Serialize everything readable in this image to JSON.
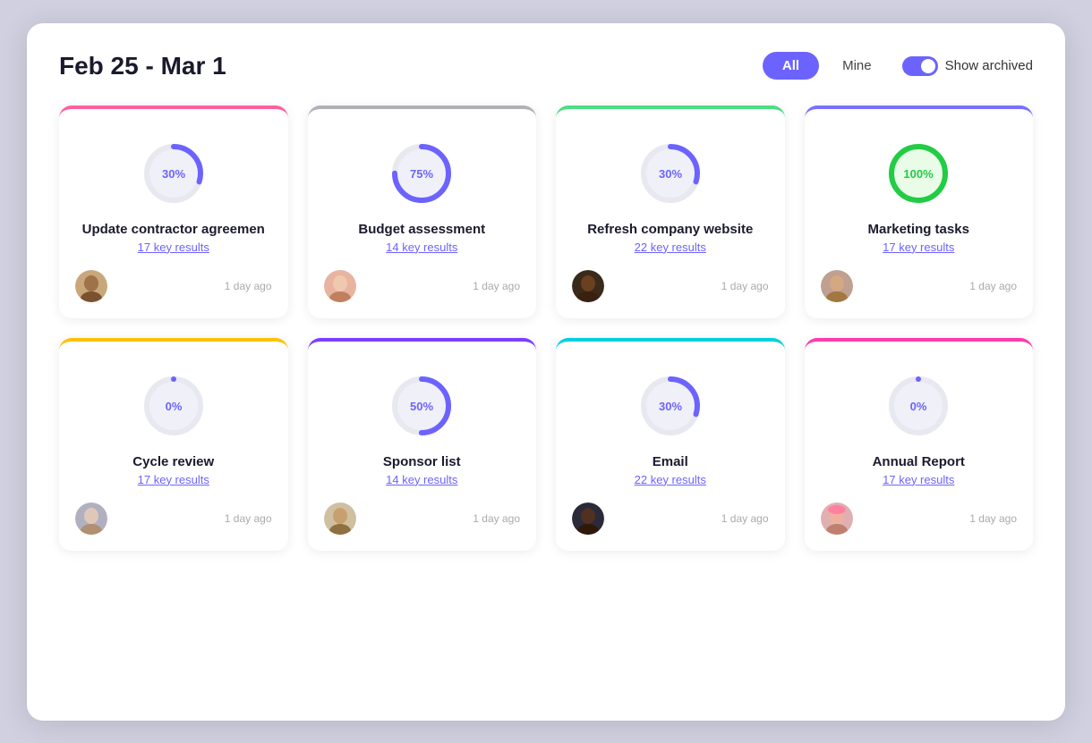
{
  "header": {
    "title": "Feb 25 - Mar 1",
    "btn_all": "All",
    "btn_mine": "Mine",
    "show_archived": "Show archived",
    "toggle_on": true
  },
  "cards": [
    {
      "id": 1,
      "title": "Update contractor agreemen",
      "key_results": "17 key results",
      "progress": 30,
      "time": "1 day ago",
      "border_color": "#ff5f9e",
      "ring_color": "#6c63ff",
      "avatar_class": "avatar-1",
      "row": 1
    },
    {
      "id": 2,
      "title": "Budget assessment",
      "key_results": "14 key results",
      "progress": 75,
      "time": "1 day ago",
      "border_color": "#b0b0b8",
      "ring_color": "#6c63ff",
      "avatar_class": "avatar-2",
      "row": 1
    },
    {
      "id": 3,
      "title": "Refresh company website",
      "key_results": "22 key results",
      "progress": 30,
      "time": "1 day ago",
      "border_color": "#4cde80",
      "ring_color": "#6c63ff",
      "avatar_class": "avatar-3",
      "row": 1
    },
    {
      "id": 4,
      "title": "Marketing tasks",
      "key_results": "17 key results",
      "progress": 100,
      "time": "1 day ago",
      "border_color": "#7b6fff",
      "ring_color": "#22cc44",
      "avatar_class": "avatar-4",
      "row": 1
    },
    {
      "id": 5,
      "title": "Cycle review",
      "key_results": "17 key results",
      "progress": 0,
      "time": "1 day ago",
      "border_color": "#ffc107",
      "ring_color": "#6c63ff",
      "avatar_class": "avatar-5",
      "row": 2
    },
    {
      "id": 6,
      "title": "Sponsor list",
      "key_results": "14 key results",
      "progress": 50,
      "time": "1 day ago",
      "border_color": "#7b3fff",
      "ring_color": "#6c63ff",
      "avatar_class": "avatar-6",
      "row": 2
    },
    {
      "id": 7,
      "title": "Email",
      "key_results": "22 key results",
      "progress": 30,
      "time": "1 day ago",
      "border_color": "#00d0e0",
      "ring_color": "#6c63ff",
      "avatar_class": "avatar-7",
      "row": 2
    },
    {
      "id": 8,
      "title": "Annual Report",
      "key_results": "17 key results",
      "progress": 0,
      "time": "1 day ago",
      "border_color": "#ff3cac",
      "ring_color": "#6c63ff",
      "avatar_class": "avatar-8",
      "row": 2
    }
  ]
}
